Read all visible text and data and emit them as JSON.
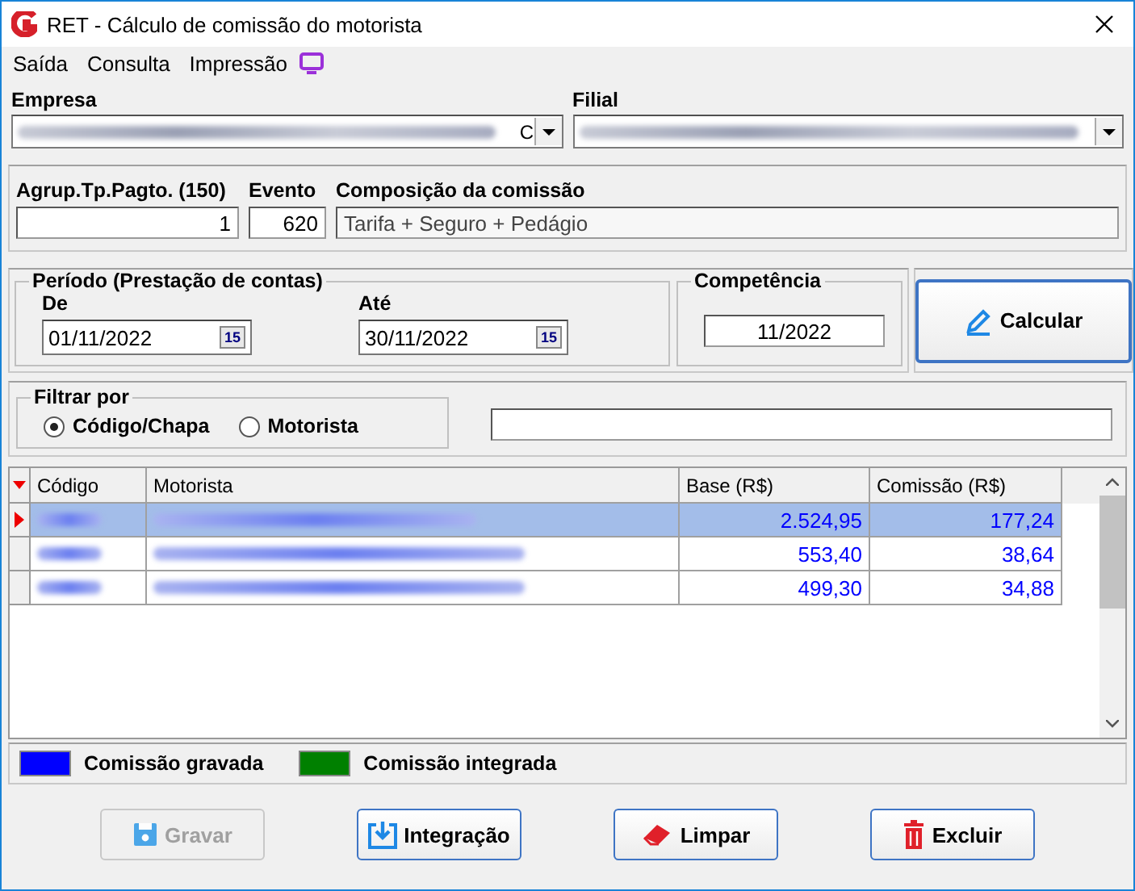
{
  "window": {
    "title": "RET - Cálculo de comissão do motorista"
  },
  "menu": [
    {
      "label": "Saída"
    },
    {
      "label": "Consulta"
    },
    {
      "label": "Impressão"
    }
  ],
  "empresa": {
    "label": "Empresa",
    "visible_tail": "C"
  },
  "filial": {
    "label": "Filial"
  },
  "agrup": {
    "label": "Agrup.Tp.Pagto. (150)",
    "value": "1"
  },
  "evento": {
    "label": "Evento",
    "value": "620"
  },
  "composicao": {
    "label": "Composição da comissão",
    "value": "Tarifa + Seguro + Pedágio"
  },
  "periodo": {
    "title": "Período (Prestação de contas)",
    "from_label": "De",
    "from": "01/11/2022",
    "to_label": "Até",
    "to": "30/11/2022",
    "from_calendar": "15",
    "to_calendar": "15"
  },
  "competencia": {
    "title": "Competência",
    "value": "11/2022"
  },
  "calcular": {
    "label": "Calcular"
  },
  "filter": {
    "title": "Filtrar por",
    "options": [
      {
        "label": "Código/Chapa",
        "selected": true
      },
      {
        "label": "Motorista",
        "selected": false
      }
    ]
  },
  "table": {
    "columns": [
      "Código",
      "Motorista",
      "Base (R$)",
      "Comissão (R$)"
    ],
    "rows": [
      {
        "base": "2.524,95",
        "comissao": "177,24",
        "selected": true
      },
      {
        "base": "553,40",
        "comissao": "38,64",
        "selected": false
      },
      {
        "base": "499,30",
        "comissao": "34,88",
        "selected": false
      }
    ]
  },
  "legend": [
    {
      "label": "Comissão gravada",
      "color": "#0000ff"
    },
    {
      "label": "Comissão integrada",
      "color": "#008000"
    }
  ],
  "buttons": [
    {
      "kind": "save",
      "label": "Gravar",
      "disabled": true
    },
    {
      "kind": "import",
      "label": "Integração",
      "disabled": false
    },
    {
      "kind": "erase",
      "label": "Limpar",
      "disabled": false
    },
    {
      "kind": "delete",
      "label": "Excluir",
      "disabled": false
    }
  ]
}
